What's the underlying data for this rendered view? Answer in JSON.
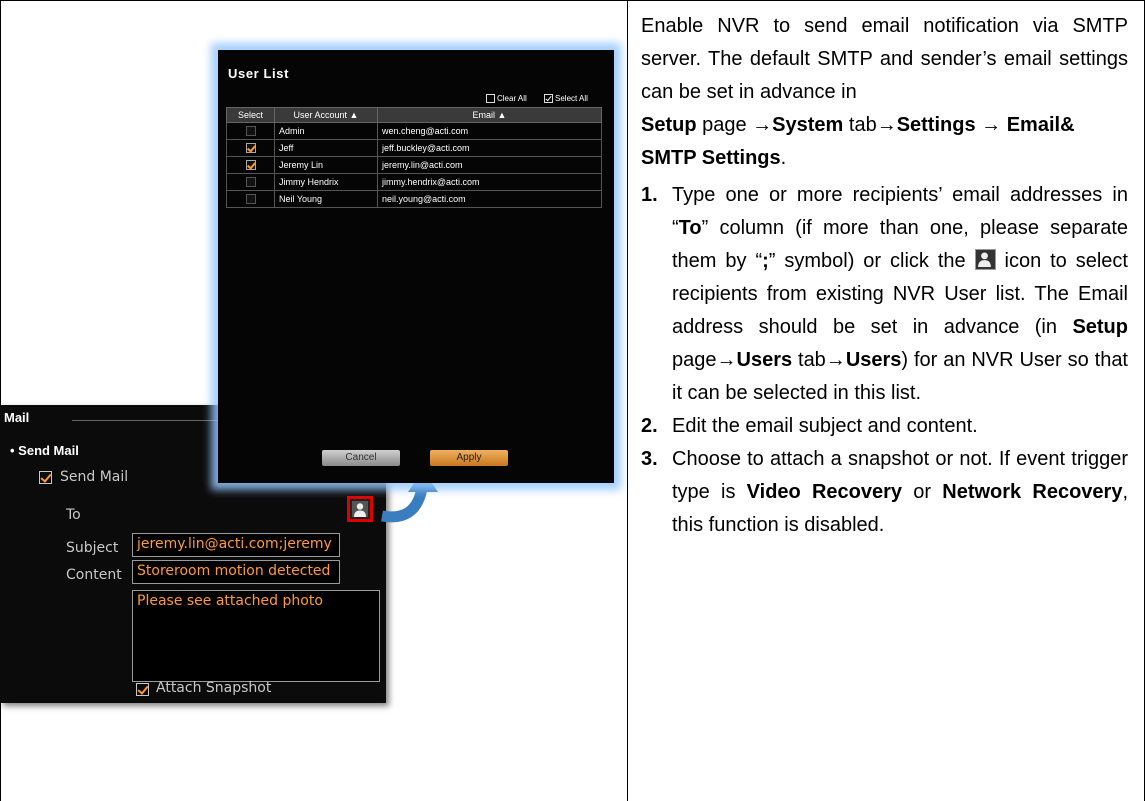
{
  "user_list": {
    "title": "User List",
    "clear_all": "Clear All",
    "select_all": "Select All",
    "columns": [
      "Select",
      "User Account ▲",
      "Email ▲"
    ],
    "rows": [
      {
        "account": "Admin",
        "email": "wen.cheng@acti.com",
        "checked": false
      },
      {
        "account": "Jeff",
        "email": "jeff.buckley@acti.com",
        "checked": true
      },
      {
        "account": "Jeremy Lin",
        "email": "jeremy.lin@acti.com",
        "checked": true
      },
      {
        "account": "Jimmy Hendrix",
        "email": "jimmy.hendrix@acti.com",
        "checked": false
      },
      {
        "account": "Neil Young",
        "email": "neil.young@acti.com",
        "checked": false
      }
    ],
    "cancel_label": "Cancel",
    "apply_label": "Apply"
  },
  "mail": {
    "heading": "Mail",
    "section": "• Send Mail",
    "send_mail_label": "Send Mail",
    "send_mail_checked": true,
    "to_label": "To",
    "to_value": "jeremy.lin@acti.com;jeremy",
    "subject_label": "Subject",
    "subject_value": "Storeroom motion detected",
    "content_label": "Content",
    "content_value": "Please see attached photo",
    "attach_label": "Attach Snapshot",
    "attach_checked": true,
    "user_icon": "user-icon"
  },
  "instructions": {
    "intro": [
      {
        "t": "Enable NVR to send email notification via SMTP server. The default SMTP and sender’s email settings can be set in advance in"
      }
    ],
    "path": [
      {
        "t": "Setup",
        "b": true
      },
      {
        "t": " page →"
      },
      {
        "t": "System",
        "b": true
      },
      {
        "t": " tab→"
      },
      {
        "t": "Settings",
        "b": true
      },
      {
        "t": " → "
      },
      {
        "t": "Email& SMTP Settings",
        "b": true
      },
      {
        "t": "."
      }
    ],
    "steps": [
      {
        "num": "1.",
        "parts": [
          {
            "t": "Type one or more recipients’ email addresses in “"
          },
          {
            "t": "To",
            "b": true
          },
          {
            "t": "” column (if more than one, please separate them by “"
          },
          {
            "t": ";",
            "b": true
          },
          {
            "t": "” symbol) or click the "
          },
          {
            "icon": "user-icon"
          },
          {
            "t": " icon to select recipients from existing NVR User list. The Email address should be set in advance (in "
          },
          {
            "t": "Setup",
            "b": true
          },
          {
            "t": " page→"
          },
          {
            "t": "Users",
            "b": true
          },
          {
            "t": " tab→"
          },
          {
            "t": "Users",
            "b": true
          },
          {
            "t": ") for an NVR User so that it can be selected in this list."
          }
        ]
      },
      {
        "num": "2.",
        "parts": [
          {
            "t": "Edit the email subject and content."
          }
        ]
      },
      {
        "num": "3.",
        "parts": [
          {
            "t": "Choose to attach a snapshot or not. If event trigger type is "
          },
          {
            "t": "Video Recovery",
            "b": true
          },
          {
            "t": " or "
          },
          {
            "t": "Network Recovery",
            "b": true
          },
          {
            "t": ", this function is disabled."
          }
        ]
      }
    ]
  },
  "colors": {
    "accent": "#ff9a35",
    "highlight": "#e00000",
    "arrow": "#3a7ec0"
  }
}
